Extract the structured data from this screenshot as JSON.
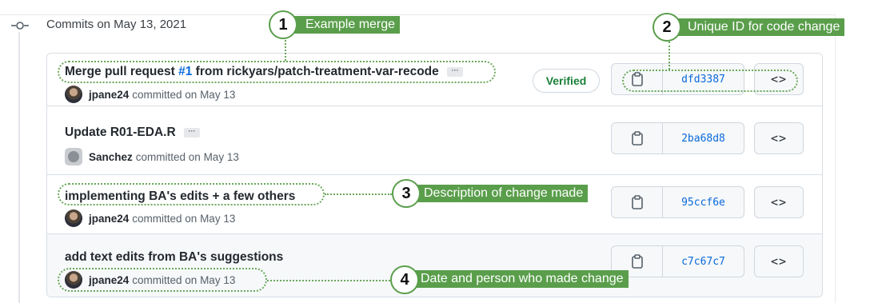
{
  "group": {
    "title": "Commits on May 13, 2021"
  },
  "commits": [
    {
      "title_prefix": "Merge pull request ",
      "pr_link": "#1",
      "title_suffix": " from rickyars/patch-treatment-var-recode",
      "author": "jpane24",
      "committed": "committed on May 13",
      "badge": "Verified",
      "sha": "dfd3387",
      "browse": "<>"
    },
    {
      "title": "Update R01-EDA.R",
      "author": "Sanchez",
      "committed": "committed on May 13",
      "sha": "2ba68d8",
      "browse": "<>"
    },
    {
      "title": "implementing BA's edits + a few others",
      "author": "jpane24",
      "committed": "committed on May 13",
      "sha": "95ccf6e",
      "browse": "<>"
    },
    {
      "title": "add text edits from BA's suggestions",
      "author": "jpane24",
      "committed": "committed on May 13",
      "sha": "c7c67c7",
      "browse": "<>"
    }
  ],
  "annotations": [
    {
      "number": "1",
      "label": "Example merge"
    },
    {
      "number": "2",
      "label": "Unique ID for code change"
    },
    {
      "number": "3",
      "label": "Description of change made"
    },
    {
      "number": "4",
      "label": "Date and person who made change"
    }
  ],
  "colors": {
    "annotation": "#5a9e4b",
    "link": "#0969da",
    "verified": "#1a7f37"
  },
  "icons": [
    "git-commit-icon",
    "clipboard-icon",
    "code-icon",
    "avatar-icon"
  ]
}
